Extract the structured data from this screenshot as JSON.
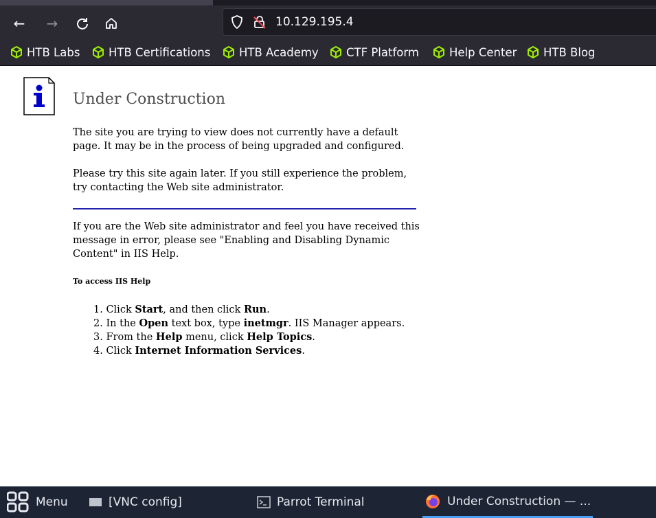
{
  "browser": {
    "url": "10.129.195.4",
    "nav_icons": [
      "back-icon",
      "forward-icon",
      "reload-icon",
      "home-icon"
    ],
    "url_icons": [
      "shield-icon",
      "insecure-lock-icon"
    ],
    "bookmarks": [
      {
        "label": "HTB Labs",
        "icon": "htb-cube-icon"
      },
      {
        "label": "HTB Certifications",
        "icon": "htb-cube-icon"
      },
      {
        "label": "HTB Academy",
        "icon": "htb-cube-icon"
      },
      {
        "label": "CTF Platform",
        "icon": "htb-cube-icon"
      },
      {
        "label": "Help Center",
        "icon": "htb-cube-icon"
      },
      {
        "label": "HTB Blog",
        "icon": "htb-cube-icon"
      }
    ],
    "accent_color": "#9fef00"
  },
  "page": {
    "title": "Under Construction",
    "para1": "The site you are trying to view does not currently have a default page. It may be in the process of being upgraded and configured.",
    "para2": "Please try this site again later. If you still experience the problem, try contacting the Web site administrator.",
    "para3": "If you are the Web site administrator and feel you have received this message in error, please see \"Enabling and Disabling Dynamic Content\" in IIS Help.",
    "help_heading": "To access IIS Help",
    "steps": [
      {
        "num": "1.",
        "a": "Click ",
        "b1": "Start",
        "c": ", and then click ",
        "b2": "Run",
        "d": "."
      },
      {
        "num": "2.",
        "a": "In the ",
        "b1": "Open",
        "c": " text box, type ",
        "b2": "inetmgr",
        "d": ". IIS Manager appears."
      },
      {
        "num": "3.",
        "a": "From the ",
        "b1": "Help",
        "c": " menu, click ",
        "b2": "Help Topics",
        "d": "."
      },
      {
        "num": "4.",
        "a": "Click ",
        "b1": "Internet Information Services",
        "c": "",
        "b2": "",
        "d": "."
      }
    ]
  },
  "taskbar": {
    "menu_label": "Menu",
    "items": [
      {
        "label": "[VNC config]",
        "icon": "window-icon"
      },
      {
        "label": "Parrot Terminal",
        "icon": "terminal-icon"
      },
      {
        "label": "Under Construction — ...",
        "icon": "firefox-icon",
        "active": true
      }
    ],
    "active_color": "#4a9ef5"
  }
}
